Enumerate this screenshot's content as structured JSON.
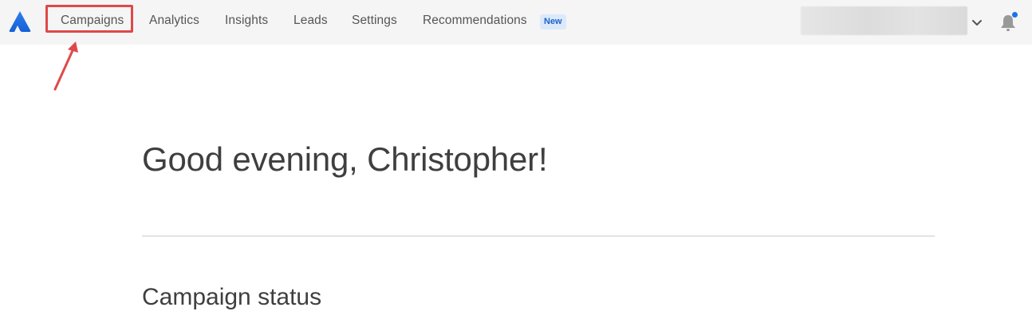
{
  "nav": {
    "items": [
      {
        "label": "Campaigns"
      },
      {
        "label": "Analytics"
      },
      {
        "label": "Insights"
      },
      {
        "label": "Leads"
      },
      {
        "label": "Settings"
      },
      {
        "label": "Recommendations"
      }
    ],
    "badge": "New"
  },
  "main": {
    "greeting": "Good evening, Christopher!",
    "section_title": "Campaign status"
  },
  "colors": {
    "brand": "#1a73e8",
    "highlight": "#e04848",
    "notification_dot": "#1a73e8"
  },
  "icons": {
    "logo": "logo-icon",
    "account_chevron": "chevron-down-icon",
    "notifications": "bell-icon"
  }
}
